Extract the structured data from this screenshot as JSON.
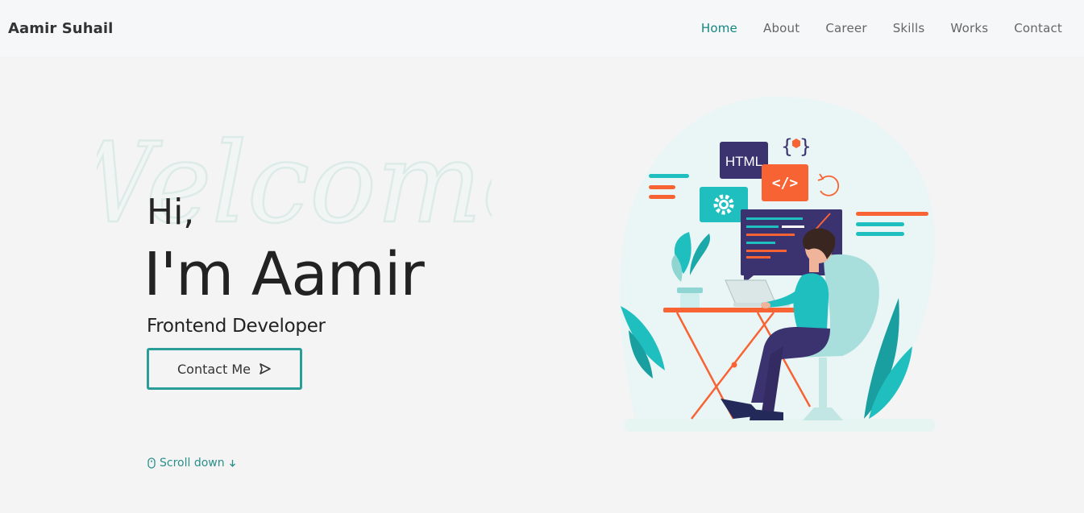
{
  "header": {
    "logo": "Aamir Suhail",
    "nav": [
      {
        "label": "Home",
        "active": true
      },
      {
        "label": "About",
        "active": false
      },
      {
        "label": "Career",
        "active": false
      },
      {
        "label": "Skills",
        "active": false
      },
      {
        "label": "Works",
        "active": false
      },
      {
        "label": "Contact",
        "active": false
      }
    ]
  },
  "hero": {
    "background_word": "Welcome",
    "greeting": "Hi,",
    "name": "I'm Aamir",
    "role": "Frontend Developer",
    "contact_button": "Contact Me",
    "scroll_down": "Scroll down"
  },
  "illustration": {
    "html_badge": "HTML",
    "code_badge": "</>",
    "braces_badge": "{ }"
  },
  "colors": {
    "accent": "#14867f",
    "teal": "#20bfbf",
    "orange": "#f86334",
    "navy": "#3b3270",
    "text_dark": "#222222",
    "nav_text": "#666666",
    "page_bg": "#f4f4f4"
  },
  "icons": {
    "send": "send-icon",
    "mouse": "mouse-icon",
    "arrow_down": "arrow-down-icon",
    "gear": "gear-icon",
    "refresh": "refresh-icon"
  }
}
